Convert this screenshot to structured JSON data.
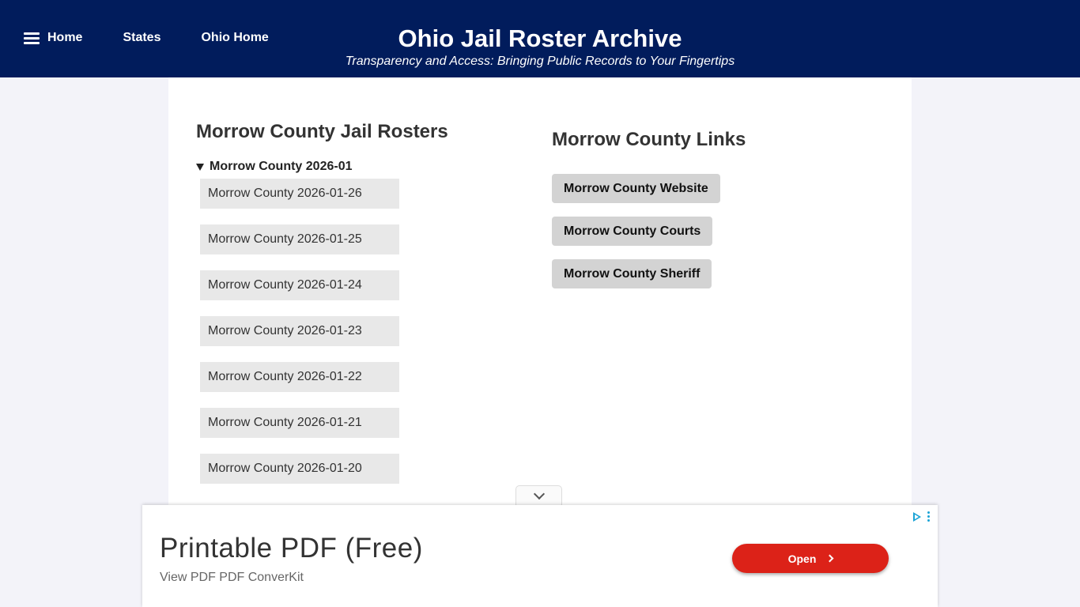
{
  "header": {
    "nav": [
      {
        "label": "Home",
        "icon": "hamburger-menu-icon"
      },
      {
        "label": "States"
      },
      {
        "label": "Ohio Home"
      }
    ],
    "title": "Ohio Jail Roster Archive",
    "tagline": "Transparency and Access: Bringing Public Records to Your Fingertips",
    "background_color": "#011c5c"
  },
  "rosters": {
    "title": "Morrow County Jail Rosters",
    "group_label": "Morrow County 2026-01",
    "items": [
      "Morrow County 2026-01-26",
      "Morrow County 2026-01-25",
      "Morrow County 2026-01-24",
      "Morrow County 2026-01-23",
      "Morrow County 2026-01-22",
      "Morrow County 2026-01-21",
      "Morrow County 2026-01-20"
    ]
  },
  "links": {
    "title": "Morrow County Links",
    "items": [
      "Morrow County Website",
      "Morrow County Courts",
      "Morrow County Sheriff"
    ]
  },
  "ad": {
    "title": "Printable PDF (Free)",
    "subtitle": "View PDF PDF ConverKit",
    "button_label": "Open",
    "button_color": "#dc2218",
    "choices_icon": "adchoices-icon"
  }
}
